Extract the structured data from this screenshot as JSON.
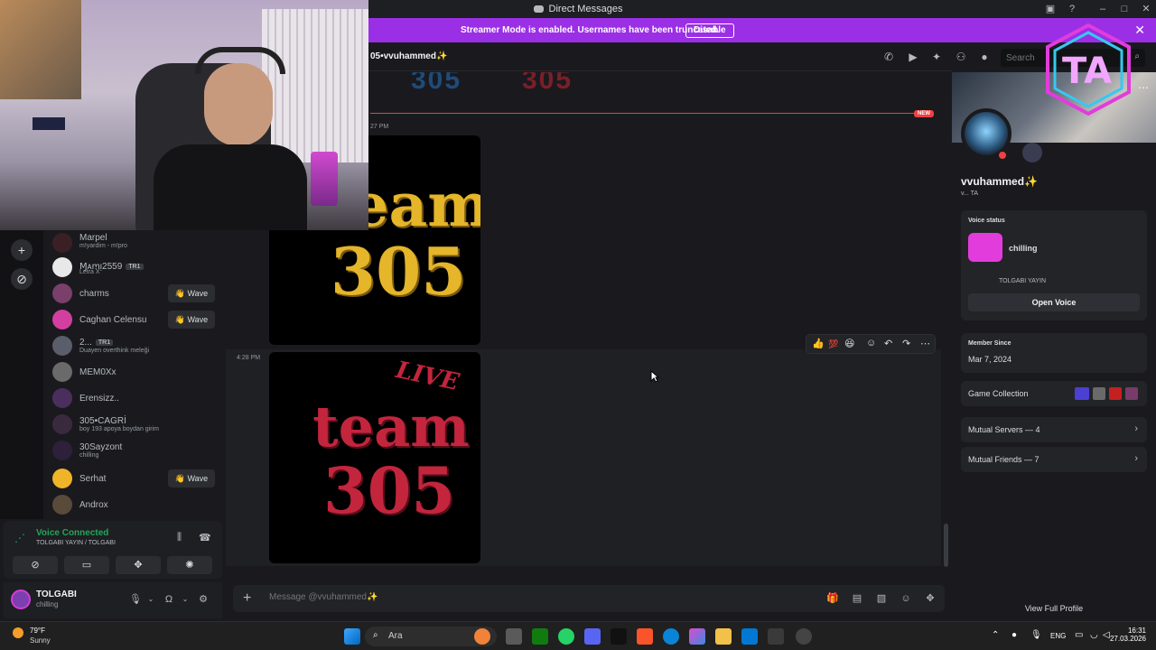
{
  "window": {
    "title": "Direct Messages",
    "banner_text": "Streamer Mode is enabled. Usernames have been truncated.",
    "banner_button": "Disable"
  },
  "header": {
    "channel_name": "05•vvuhammed✨",
    "search_placeholder": "Search"
  },
  "members": [
    {
      "name": "Marpel",
      "sub": "m!yardim - m!pro",
      "wave": null
    },
    {
      "name": "Ɱᴀꭑᴉ2559",
      "tag": "TR1",
      "sub": "Letra X",
      "wave": null
    },
    {
      "name": "charms",
      "sub": "",
      "wave": "Wave"
    },
    {
      "name": "Caghan Celensu",
      "sub": "",
      "wave": "Wave"
    },
    {
      "name": "2...",
      "tag": "TR1",
      "sub": "Duayen overthink meleği",
      "wave": null
    },
    {
      "name": "MEM0Xx",
      "sub": "",
      "wave": null
    },
    {
      "name": "Erensizz..",
      "sub": "",
      "wave": null
    },
    {
      "name": "305•CAGRİ",
      "sub": "boy 193 apoya boydan girim",
      "wave": null
    },
    {
      "name": "30Sayzont",
      "sub": "chilling",
      "wave": null
    },
    {
      "name": "Serhat",
      "sub": "",
      "wave": "Wave"
    },
    {
      "name": "Androx",
      "sub": "",
      "wave": null
    }
  ],
  "voice": {
    "status": "Voice Connected",
    "channel": "TOLGABI YAYIN / TOLGABI"
  },
  "user": {
    "name": "TOLGABI",
    "status": "chilling"
  },
  "chat": {
    "new_badge": "NEW",
    "timestamp_1": "27 PM",
    "timestamp_2": "4:28 PM",
    "image_1_line1": "team",
    "image_1_line2": "305",
    "image_2_live": "LIVE",
    "image_2_line1": "team",
    "image_2_line2": "305",
    "composer_placeholder": "Message @vvuhammed✨"
  },
  "profile": {
    "name": "vvuhammed✨",
    "tags": "v...  TA",
    "voice_status_label": "Voice status",
    "voice_status_value": "chilling",
    "voice_channel": "TOLGABI YAYIN",
    "open_voice": "Open Voice",
    "member_since_label": "Member Since",
    "member_since_value": "Mar 7, 2024",
    "game_collection": "Game Collection",
    "mutual_servers": "Mutual Servers — 4",
    "mutual_friends": "Mutual Friends — 7",
    "view_full": "View Full Profile"
  },
  "taskbar": {
    "temp": "79°F",
    "condition": "Sunny",
    "search_text": "Ara",
    "language": "ENG",
    "time": "16:31",
    "date": "27.03.2026"
  },
  "colors": {
    "banner": "#9b2fe6",
    "accent_green": "#23a55a",
    "new_red": "#f23f42",
    "gold": "#e5b52a",
    "crimson": "#c3253d"
  }
}
